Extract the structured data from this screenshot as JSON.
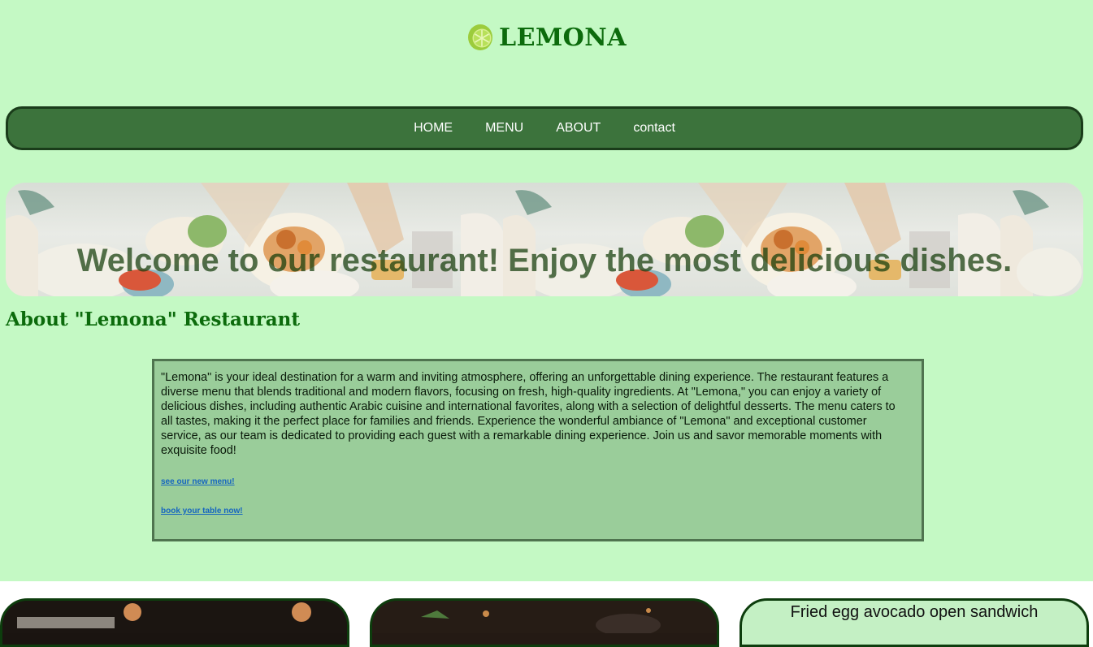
{
  "brand": {
    "name": "LEMONA"
  },
  "nav": {
    "items": [
      {
        "label": "HOME"
      },
      {
        "label": "MENU"
      },
      {
        "label": "ABOUT"
      },
      {
        "label": "contact"
      }
    ]
  },
  "hero": {
    "title": "Welcome to our restaurant! Enjoy the most delicious dishes."
  },
  "about": {
    "heading": "About \"Lemona\" Restaurant",
    "body": "\"Lemona\" is your ideal destination for a warm and inviting atmosphere, offering an unforgettable dining experience. The restaurant features a diverse menu that blends traditional and modern flavors, focusing on fresh, high-quality ingredients. At \"Lemona,\" you can enjoy a variety of delicious dishes, including authentic Arabic cuisine and international favorites, along with a selection of delightful desserts. The menu caters to all tastes, making it the perfect place for families and friends. Experience the wonderful ambiance of \"Lemona\" and exceptional customer service, as our team is dedicated to providing each guest with a remarkable dining experience. Join us and savor memorable moments with exquisite food!",
    "link_menu": "see our new menu!",
    "link_book": "book your table now!"
  },
  "cards": [
    {
      "title": ""
    },
    {
      "title": ""
    },
    {
      "title": "Fried egg avocado open sandwich"
    }
  ],
  "colors": {
    "page_bg": "#c4f9c4",
    "nav_bg": "#3c733c",
    "heading": "#0c6b0c",
    "about_box": "#9acd9a",
    "link": "#1565c0"
  }
}
